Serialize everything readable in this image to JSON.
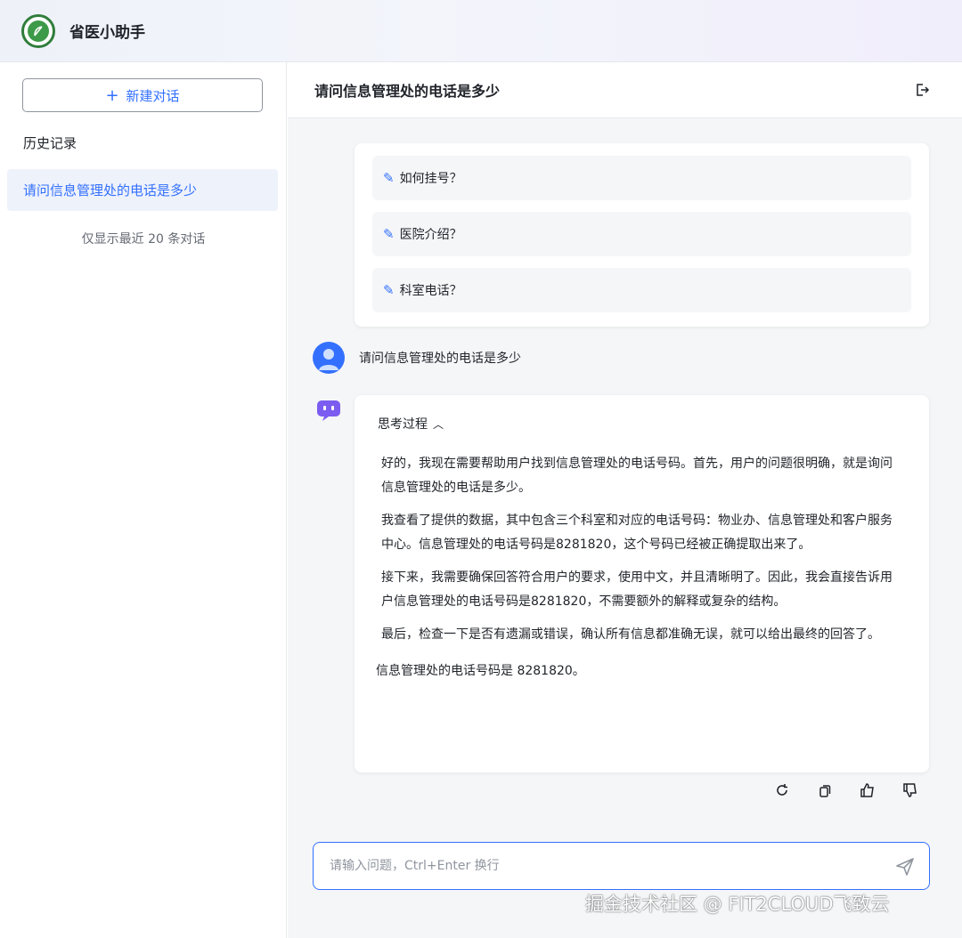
{
  "app": {
    "title": "省医小助手",
    "logo_icon": "leaf-logo-icon",
    "brand_color": "#2f7d3a",
    "accent": "#3370ff"
  },
  "sidebar": {
    "new_chat_label": "新建对话",
    "history_title": "历史记录",
    "history_items": [
      {
        "label": "请问信息管理处的电话是多少"
      }
    ],
    "history_note": "仅显示最近 20 条对话"
  },
  "chat": {
    "title": "请问信息管理处的电话是多少",
    "suggestions": [
      {
        "label": "如何挂号？"
      },
      {
        "label": "医院介绍？"
      },
      {
        "label": "科室电话？"
      }
    ],
    "user_message": "请问信息管理处的电话是多少",
    "thinking_label": "思考过程",
    "thinking_paragraphs": [
      "好的，我现在需要帮助用户找到信息管理处的电话号码。首先，用户的问题很明确，就是询问信息管理处的电话是多少。",
      "我查看了提供的数据，其中包含三个科室和对应的电话号码：物业办、信息管理处和客户服务中心。信息管理处的电话号码是8281820，这个号码已经被正确提取出来了。",
      "接下来，我需要确保回答符合用户的要求，使用中文，并且清晰明了。因此，我会直接告诉用户信息管理处的电话号码是8281820，不需要额外的解释或复杂的结构。",
      "最后，检查一下是否有遗漏或错误，确认所有信息都准确无误，就可以给出最终的回答了。"
    ],
    "final_answer": "信息管理处的电话号码是 8281820。"
  },
  "input": {
    "placeholder": "请输入问题，Ctrl+Enter 换行",
    "value": ""
  },
  "watermark": "掘金技术社区 @ FIT2CLOUD飞致云"
}
